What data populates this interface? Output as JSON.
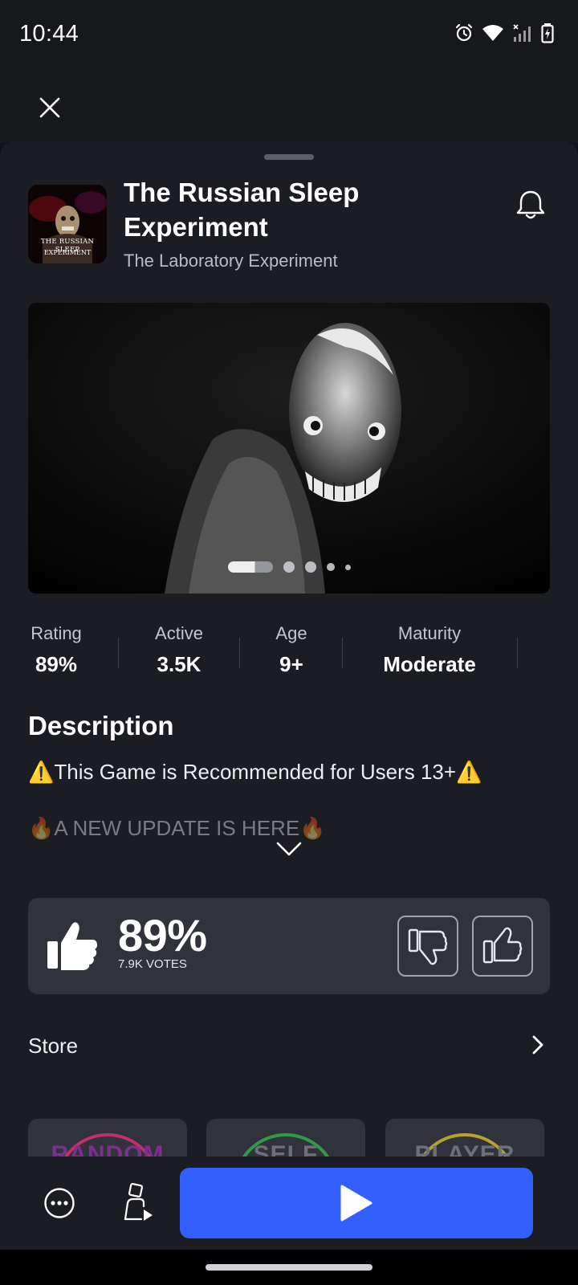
{
  "status_bar": {
    "time": "10:44",
    "icons": [
      "alarm-icon",
      "wifi-icon",
      "signal-icon",
      "battery-charging-icon"
    ]
  },
  "header": {
    "close_icon": "close-icon"
  },
  "game": {
    "title": "The Russian Sleep Experiment",
    "creator": "The Laboratory Experiment",
    "thumbnail_text_line1": "THE RUSSIAN SLEEP",
    "thumbnail_text_line2": "EXPERIMENT",
    "notify_icon": "bell-icon"
  },
  "media": {
    "slide_count": 5,
    "active_slide": 1
  },
  "stats": [
    {
      "label": "Rating",
      "value": "89%"
    },
    {
      "label": "Active",
      "value": "3.5K"
    },
    {
      "label": "Age",
      "value": "9+"
    },
    {
      "label": "Maturity",
      "value": "Moderate"
    }
  ],
  "description": {
    "heading": "Description",
    "line1": "⚠️This Game is Recommended for Users 13+⚠️",
    "line2": "🔥A NEW UPDATE IS HERE🔥"
  },
  "votes": {
    "percent": "89%",
    "count": "7.9K VOTES",
    "thumbs_down_icon": "thumbs-down-icon",
    "thumbs_up_icon": "thumbs-up-icon"
  },
  "store": {
    "label": "Store",
    "items": [
      {
        "text": "RANDOM",
        "color": "#c0306a"
      },
      {
        "text": "SELF",
        "color": "#2f9a4a"
      },
      {
        "text": "PLAYER",
        "color": "#b8a22a"
      }
    ]
  },
  "actions": {
    "more_icon": "more-options-icon",
    "avatar_icon": "avatar-play-icon",
    "play_icon": "play-icon",
    "play_color": "#335fff"
  }
}
